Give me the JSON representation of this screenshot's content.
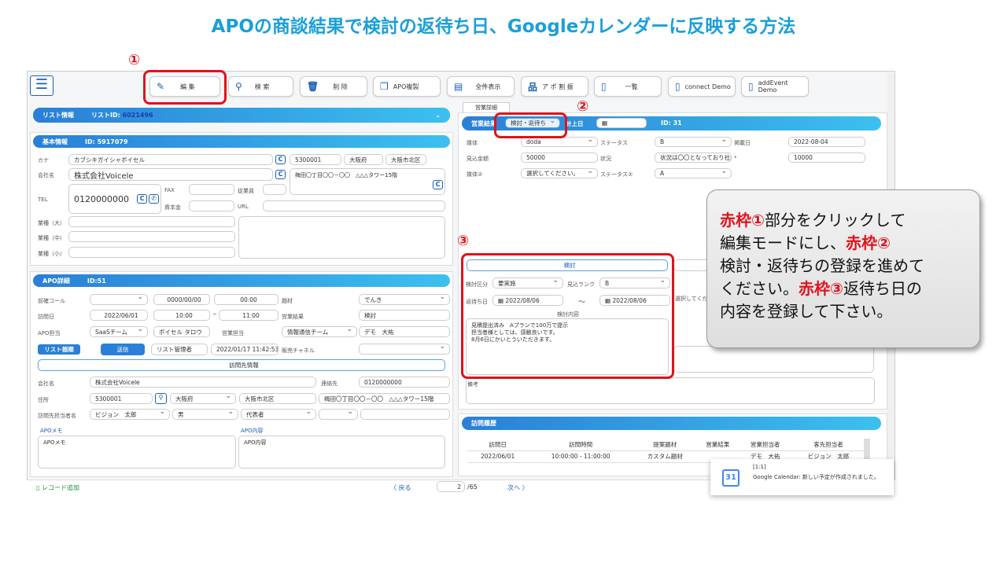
{
  "title": "APOの商談結果で検討の返待ち日、Googleカレンダーに反映する方法",
  "toolbar": {
    "edit": "編 集",
    "search": "検 索",
    "delete": "削 除",
    "copy": "APO複製",
    "showall": "全件表示",
    "assign": "ア ポ 割 振",
    "list": "一覧",
    "connect": "connect Demo",
    "addevent": "addEvent Demo"
  },
  "annotations": {
    "n1": "①",
    "n2": "②",
    "n3": "③"
  },
  "listinfo": {
    "label": "リスト情報",
    "id_label": "リストID:",
    "id": "6021496"
  },
  "basic": {
    "label": "基本情報",
    "id": "ID: 5917079",
    "kana_l": "カナ",
    "kana": "カブシキガイシャボイセル",
    "zip": "5300001",
    "pref": "大阪府",
    "city": "大阪市北区",
    "company_l": "会社名",
    "company": "株式会社Voicele",
    "addr": "梅田〇丁目〇〇－〇〇　△△△タワー15階",
    "tel_l": "TEL",
    "tel": "0120000000",
    "fax": "FAX",
    "emp": "従業員",
    "capital": "資本金",
    "url": "URL",
    "ind1": "業種（大）",
    "ind2": "業種（中）",
    "ind3": "業種（小）"
  },
  "apo": {
    "label": "APO詳細",
    "id": "ID:51",
    "precall_l": "前確コール",
    "precall_date": "0000/00/00",
    "precall_time": "00:00",
    "material_l": "題材",
    "material": "でんき",
    "visit_l": "訪問日",
    "visit_date": "2022/06/01",
    "visit_from": "10:00",
    "tilde": "~",
    "visit_to": "11:00",
    "result_l": "営業結果",
    "result": "検討",
    "owner_l": "APO担当",
    "team": "SaaSチーム",
    "owner": "ボイセル タロウ",
    "sales_l": "営業担当",
    "sales_team": "情報通信チーム",
    "sales_person": "デモ　大祐",
    "list_sort": "リスト振順",
    "send": "送信",
    "manager": "リスト管理者",
    "datetime": "2022/01/17 11:42:53",
    "channel_l": "販売チャネル",
    "visit_info": "訪問先情報",
    "co_l": "会社名",
    "co": "株式会社Voicele",
    "contact_l": "連絡先",
    "contact": "0120000000",
    "addr_l": "住所",
    "zip": "5300001",
    "pref": "大阪府",
    "city": "大阪市北区",
    "street": "梅田〇丁目〇〇－〇〇　△△△タワー15階",
    "person_l": "訪問先担当者名",
    "person": "ビジョン　太郎",
    "gender": "男",
    "role": "代表者",
    "memo_l": "APOメモ",
    "memo": "APOメモ",
    "content_l": "APO内容",
    "content": "APO内容"
  },
  "sales": {
    "tab": "営業詳細",
    "result_l": "営業結果",
    "result": "検討・返待ち",
    "booked": "計上日",
    "id": "ID: 31",
    "media_l": "媒体",
    "media": "doda",
    "status_l": "ステータス",
    "status": "B",
    "post_l": "掲載日",
    "post": "2022-08-04",
    "amount_l": "見込金額",
    "amount": "50000",
    "cond_l": "状況",
    "cond": "状況は〇〇となっており社内",
    "star": "*",
    "amount2": "10000",
    "media2_l": "媒体②",
    "media2": "選択してください。",
    "status2_l": "ステータス②",
    "status2": "A"
  },
  "review": {
    "head": "検討",
    "cat_l": "検討区分",
    "cat": "要実施",
    "rank_l": "見込ランク",
    "rank": "B",
    "date_l": "返待ち日",
    "date1": "2022/08/06",
    "tilde": "〜",
    "date2": "2022/08/06",
    "content_l": "検討内容",
    "text1": "見積提出済み　Aプランで100万で提示",
    "text2": "担当者様としては、感触良いです。",
    "text3": "8月6日にかいとういただきます。",
    "select": "選択してくだ",
    "remarks": "備考"
  },
  "history": {
    "label": "訪問履歴",
    "headers": [
      "訪問日",
      "訪問時間",
      "提案題材",
      "営業結果",
      "営業担当者",
      "客先担当者"
    ],
    "row": [
      "2022/06/01",
      "10:00:00 - 11:00:00",
      "カスタム題材",
      "",
      "デモ　大祐",
      "ビジョン　太郎"
    ]
  },
  "footer": {
    "add": "レコード追加",
    "prev": "〈 戻る",
    "page": "2",
    "total": "/65",
    "next": "次へ 〉"
  },
  "toast": {
    "icon": "31",
    "tag": "[1:1]",
    "msg": "Google Calendar: 新しい予定が作成されました。"
  },
  "callout": {
    "r1": "赤枠①",
    "t1": "部分をクリックして",
    "t2": "編集モードにし、",
    "r2": "赤枠②",
    "t3": "検討・返待ちの登録を進めて",
    "t4": "ください。",
    "r3": "赤枠③",
    "t5": "返待ち日の",
    "t6": "内容を登録して下さい。"
  }
}
